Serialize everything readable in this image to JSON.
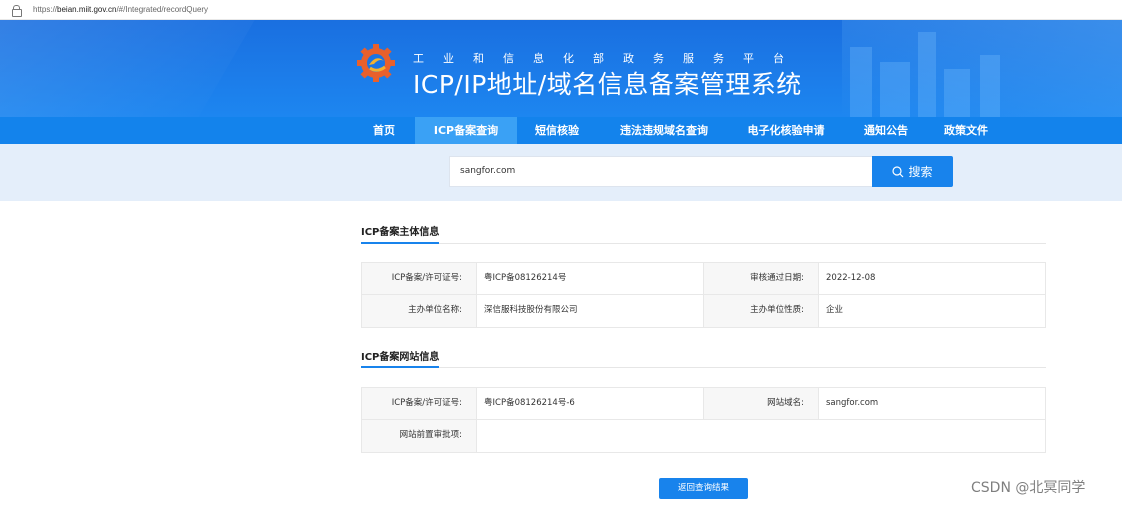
{
  "browser": {
    "url_prefix": "https://",
    "url_host": "beian.miit.gov.cn",
    "url_path": "/#/Integrated/recordQuery"
  },
  "header": {
    "subtitle": "工业和信息化部政务服务平台",
    "title": "ICP/IP地址/域名信息备案管理系统"
  },
  "nav": {
    "items": [
      {
        "label": "首页",
        "active": false
      },
      {
        "label": "ICP备案查询",
        "active": true
      },
      {
        "label": "短信核验",
        "active": false
      },
      {
        "label": "违法违规域名查询",
        "active": false
      },
      {
        "label": "电子化核验申请",
        "active": false
      },
      {
        "label": "通知公告",
        "active": false
      },
      {
        "label": "政策文件",
        "active": false
      }
    ]
  },
  "search": {
    "value": "sangfor.com",
    "button_label": "搜索"
  },
  "subject_info": {
    "title": "ICP备案主体信息",
    "rows": [
      {
        "label1": "ICP备案/许可证号:",
        "value1": "粤ICP备08126214号",
        "label2": "审核通过日期:",
        "value2": "2022-12-08"
      },
      {
        "label1": "主办单位名称:",
        "value1": "深信服科技股份有限公司",
        "label2": "主办单位性质:",
        "value2": "企业"
      }
    ]
  },
  "website_info": {
    "title": "ICP备案网站信息",
    "rows": [
      {
        "label1": "ICP备案/许可证号:",
        "value1": "粤ICP备08126214号-6",
        "label2": "网站域名:",
        "value2": "sangfor.com"
      },
      {
        "label1": "网站前置审批项:",
        "value1": ""
      }
    ]
  },
  "back_button_label": "返回查询结果",
  "watermark": "CSDN @北冥同学",
  "colors": {
    "primary": "#1883ec",
    "banner": "#1a6fe0",
    "nav_active": "#3aa1f5",
    "search_bg": "#e4eefa"
  }
}
